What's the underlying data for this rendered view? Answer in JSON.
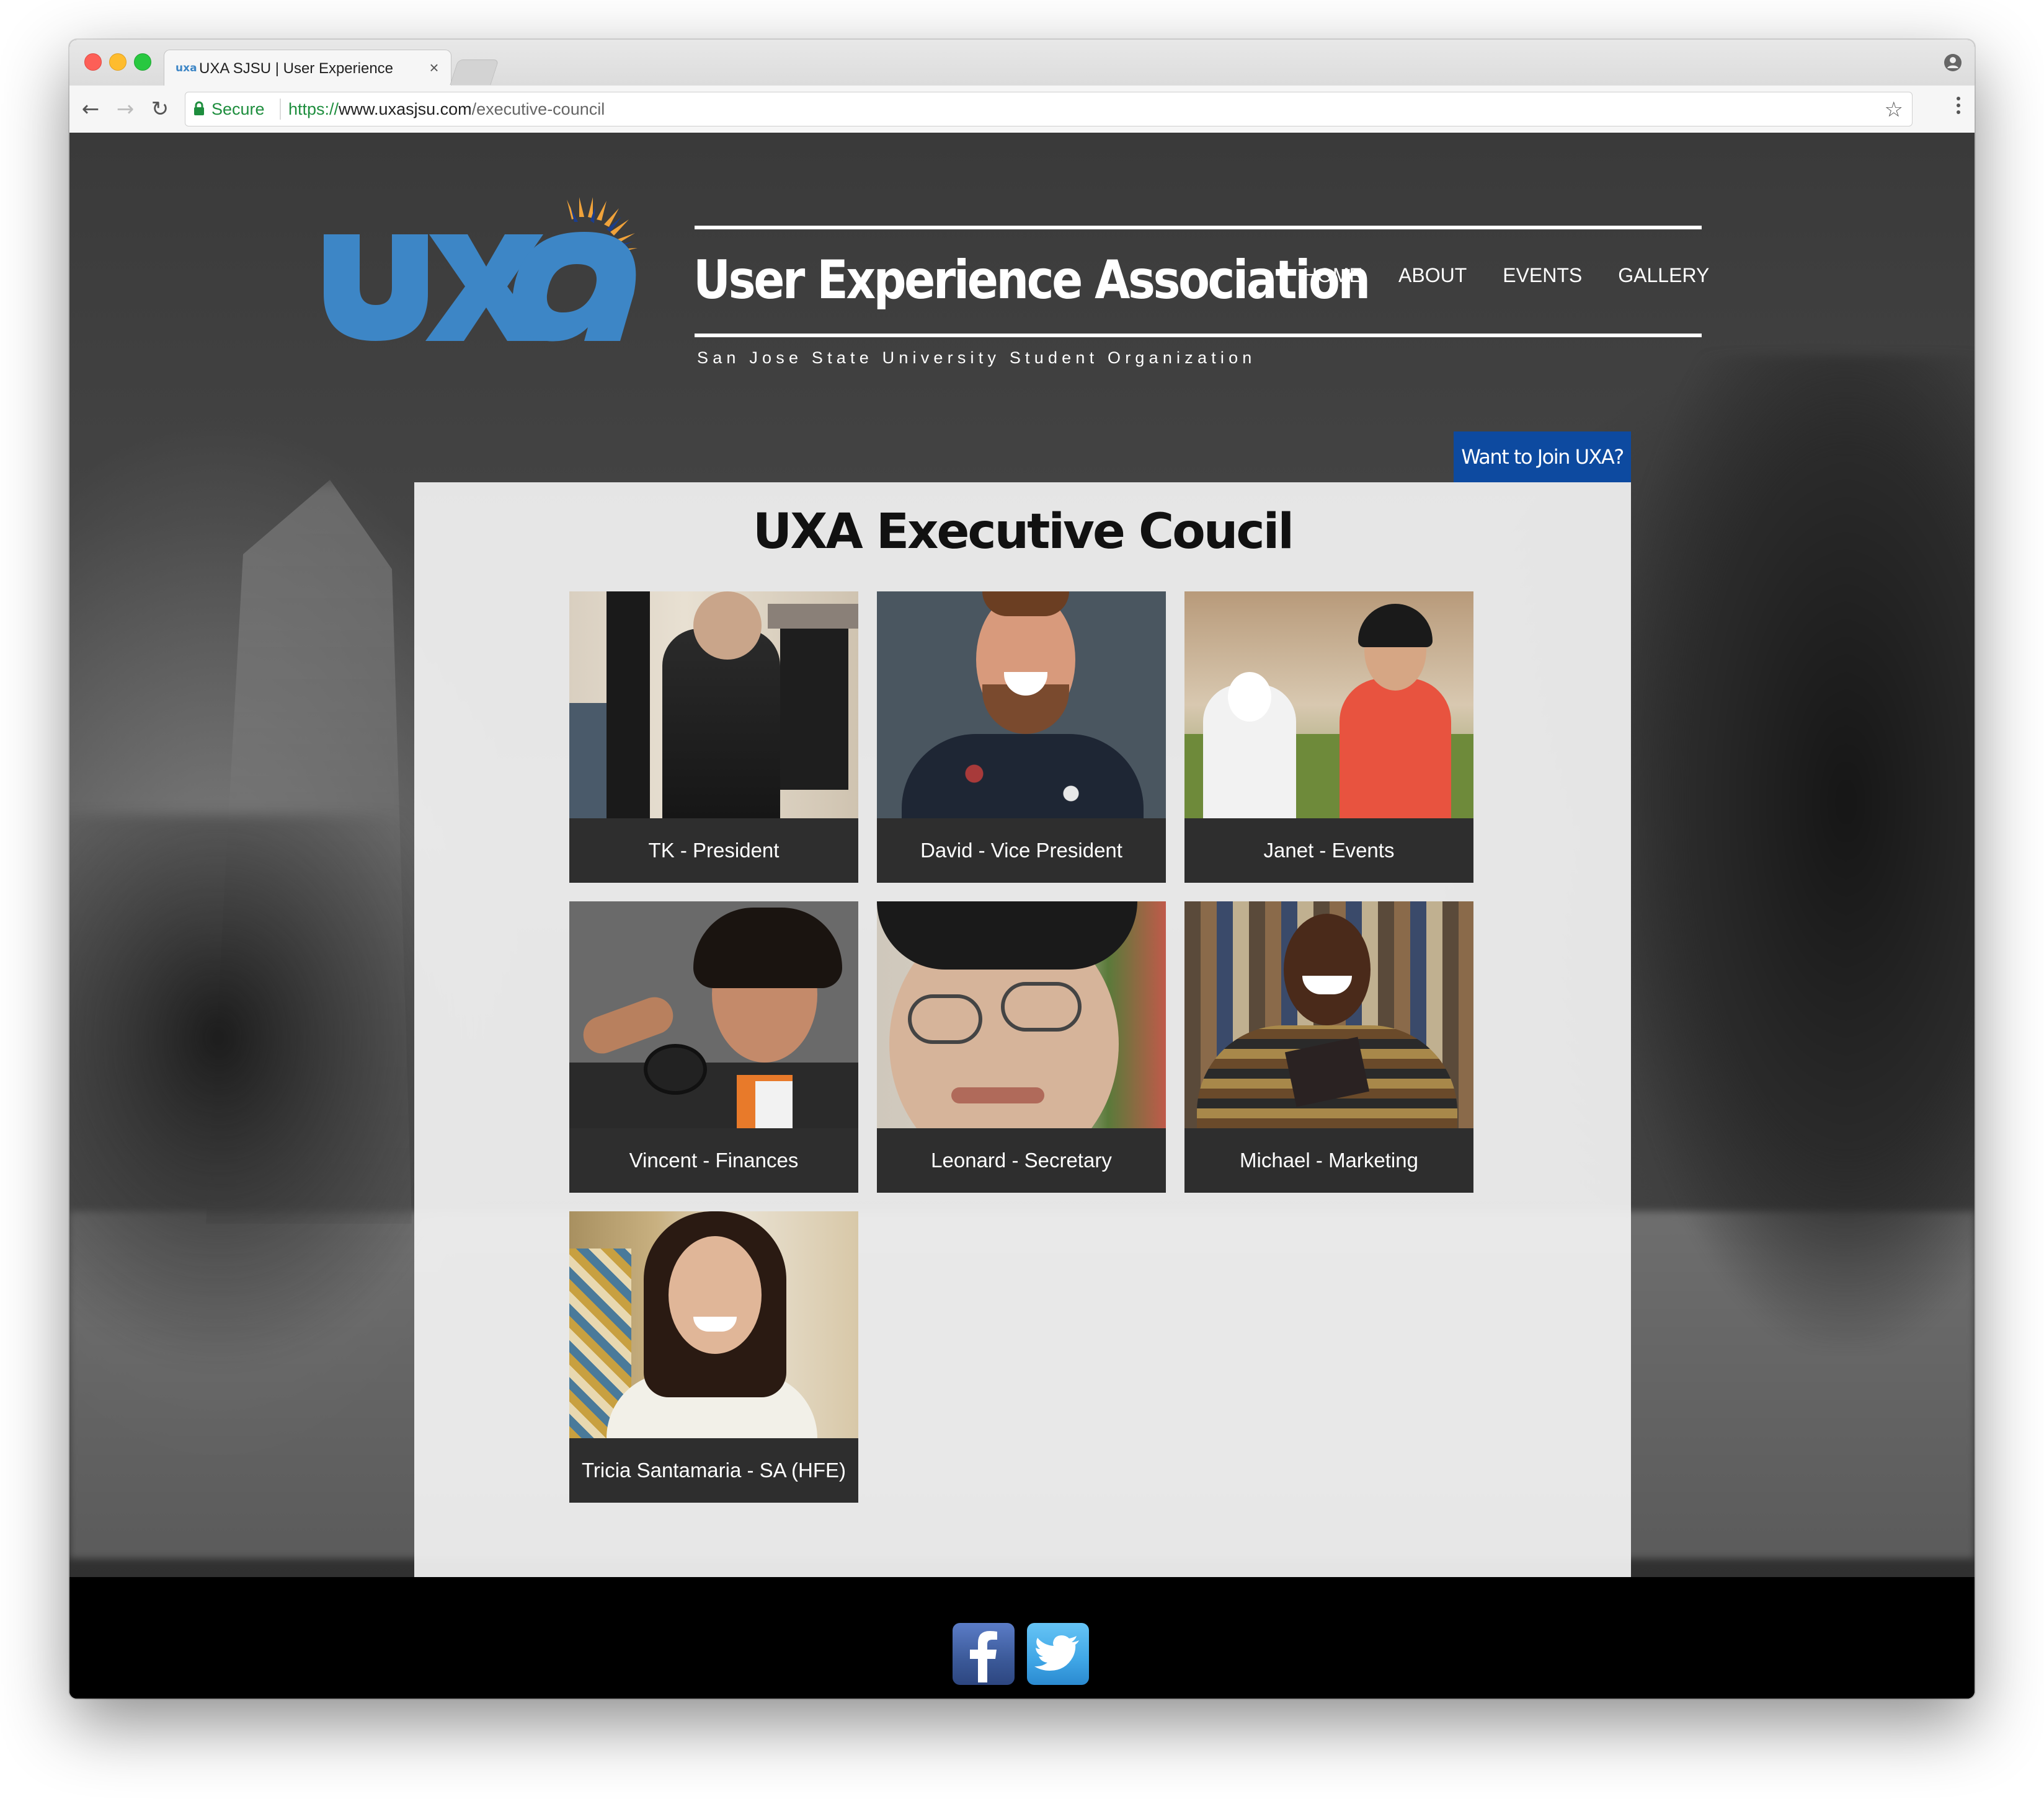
{
  "browser": {
    "tab_title": "UXA SJSU | User Experience",
    "tab_close": "×",
    "tab_favicon_text": "uxa",
    "secure_label": "Secure",
    "url_scheme": "https://",
    "url_host": "www.uxasjsu.com",
    "url_path": "/executive-council",
    "icons": [
      "back-arrow-icon",
      "forward-arrow-icon",
      "reload-icon",
      "lock-icon",
      "star-icon",
      "menu-icon",
      "profile-icon"
    ]
  },
  "header": {
    "logo_text": "uxa",
    "title": "User Experience Association",
    "subtitle": "San Jose State University Student Organization",
    "nav": [
      {
        "label": "HOME"
      },
      {
        "label": "ABOUT"
      },
      {
        "label": "EVENTS"
      },
      {
        "label": "GALLERY"
      }
    ],
    "join_button": "Want to Join UXA?",
    "colors": {
      "logo_blue": "#3d86c6",
      "logo_orange": "#f0a23a",
      "join_button": "#0d4aa0"
    }
  },
  "main": {
    "title": "UXA Executive Coucil",
    "members": [
      {
        "label": "TK - President"
      },
      {
        "label": "David - Vice President"
      },
      {
        "label": "Janet - Events"
      },
      {
        "label": "Vincent - Finances"
      },
      {
        "label": "Leonard - Secretary"
      },
      {
        "label": "Michael - Marketing"
      },
      {
        "label": "Tricia Santamaria - SA (HFE)"
      }
    ]
  },
  "footer": {
    "social": [
      {
        "name": "facebook-icon",
        "glyph": "f"
      },
      {
        "name": "twitter-icon",
        "glyph": "bird"
      }
    ]
  }
}
